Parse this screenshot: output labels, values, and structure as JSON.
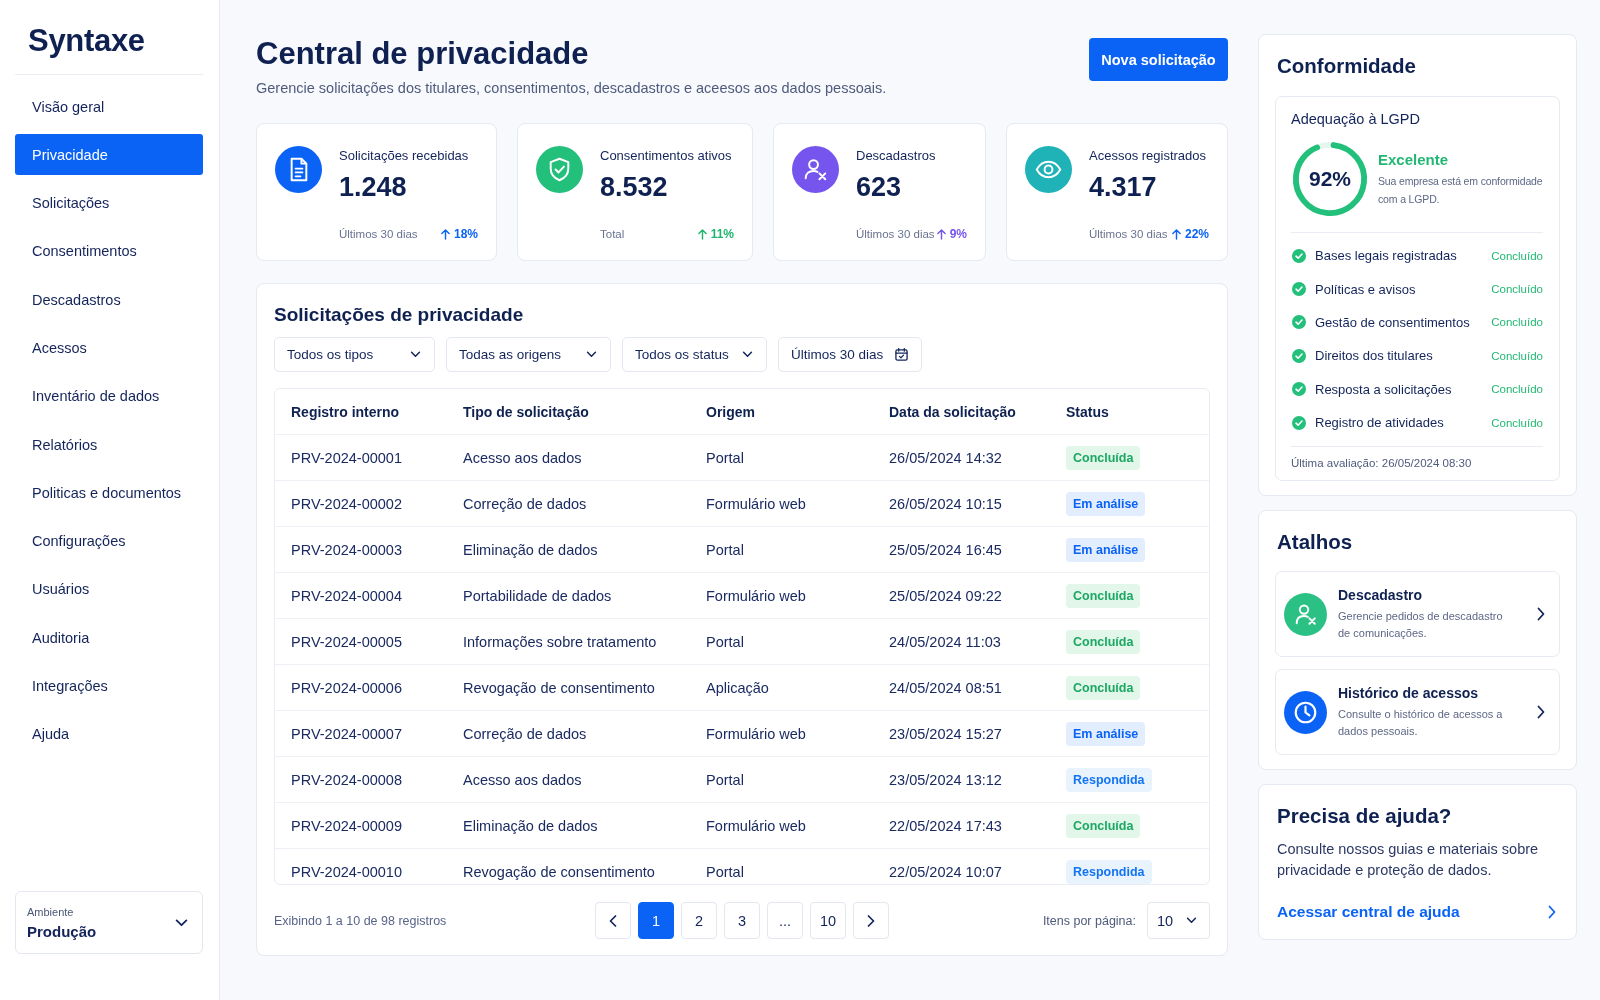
{
  "sidebar": {
    "logo": "Syntaxe",
    "items": [
      {
        "label": "Visão geral",
        "selected": false
      },
      {
        "label": "Privacidade",
        "selected": true
      },
      {
        "label": "Solicitações",
        "selected": false
      },
      {
        "label": "Consentimentos",
        "selected": false
      },
      {
        "label": "Descadastros",
        "selected": false
      },
      {
        "label": "Acessos",
        "selected": false
      },
      {
        "label": "Inventário de dados",
        "selected": false
      },
      {
        "label": "Relatórios",
        "selected": false
      },
      {
        "label": "Politicas e documentos",
        "selected": false
      },
      {
        "label": "Configurações",
        "selected": false
      },
      {
        "label": "Usuários",
        "selected": false
      },
      {
        "label": "Auditoria",
        "selected": false
      },
      {
        "label": "Integrações",
        "selected": false
      },
      {
        "label": "Ajuda",
        "selected": false
      }
    ],
    "environment": {
      "label": "Ambiente",
      "value": "Produção"
    }
  },
  "header": {
    "title": "Central de privacidade",
    "subtitle": "Gerencie solicitações dos titulares, consentimentos, descadastros e aceesos aos dados pessoais.",
    "primary_button": "Nova solicitação"
  },
  "stats": [
    {
      "kind": "document",
      "color": "#0b63f6",
      "label": "Solicitações recebidas",
      "value": "1.248",
      "period": "Últimos 30 dias",
      "trend": {
        "value": "18%",
        "color": "#0b63f6"
      }
    },
    {
      "kind": "shield",
      "color": "#22c07a",
      "label": "Consentimentos ativos",
      "value": "8.532",
      "period": "Total",
      "trend": {
        "value": "11%",
        "color": "#1fb46e"
      }
    },
    {
      "kind": "user-x",
      "color": "#7655ee",
      "label": "Descadastros",
      "value": "623",
      "period": "Últimos 30 dias",
      "trend": {
        "value": "9%",
        "color": "#7655ee"
      }
    },
    {
      "kind": "eye",
      "color": "#1fb3b8",
      "label": "Acessos registrados",
      "value": "4.317",
      "period": "Últimos 30 dias",
      "trend": {
        "value": "22%",
        "color": "#0b63f6"
      }
    }
  ],
  "requests": {
    "title": "Solicitações de privacidade",
    "filters": [
      {
        "kind": "select",
        "value": "Todos os tipos"
      },
      {
        "kind": "select",
        "value": "Todas as origens"
      },
      {
        "kind": "select",
        "value": "Todos os status"
      },
      {
        "kind": "date",
        "value": "Últimos 30 dias"
      }
    ],
    "table": {
      "columns": [
        "Registro interno",
        "Tipo de solicitação",
        "Origem",
        "Data da solicitação",
        "Status"
      ],
      "rows": [
        {
          "id": "PRV-2024-00001",
          "type": "Acesso aos dados",
          "origin": "Portal",
          "date": "26/05/2024 14:32",
          "status": {
            "label": "Concluída",
            "kind": "done"
          }
        },
        {
          "id": "PRV-2024-00002",
          "type": "Correção de dados",
          "origin": "Formulário web",
          "date": "26/05/2024 10:15",
          "status": {
            "label": "Em análise",
            "kind": "review"
          }
        },
        {
          "id": "PRV-2024-00003",
          "type": "Eliminação de dados",
          "origin": "Portal",
          "date": "25/05/2024 16:45",
          "status": {
            "label": "Em análise",
            "kind": "review"
          }
        },
        {
          "id": "PRV-2024-00004",
          "type": "Portabilidade de dados",
          "origin": "Formulário web",
          "date": "25/05/2024 09:22",
          "status": {
            "label": "Concluída",
            "kind": "done"
          }
        },
        {
          "id": "PRV-2024-00005",
          "type": "Informações sobre tratamento",
          "origin": "Portal",
          "date": "24/05/2024 11:03",
          "status": {
            "label": "Concluída",
            "kind": "done"
          }
        },
        {
          "id": "PRV-2024-00006",
          "type": "Revogação de consentimento",
          "origin": "Aplicação",
          "date": "24/05/2024 08:51",
          "status": {
            "label": "Concluída",
            "kind": "done"
          }
        },
        {
          "id": "PRV-2024-00007",
          "type": "Correção de dados",
          "origin": "Formulário web",
          "date": "23/05/2024 15:27",
          "status": {
            "label": "Em análise",
            "kind": "review"
          }
        },
        {
          "id": "PRV-2024-00008",
          "type": "Acesso aos dados",
          "origin": "Portal",
          "date": "23/05/2024 13:12",
          "status": {
            "label": "Respondida",
            "kind": "answered"
          }
        },
        {
          "id": "PRV-2024-00009",
          "type": "Eliminação de dados",
          "origin": "Formulário web",
          "date": "22/05/2024 17:43",
          "status": {
            "label": "Concluída",
            "kind": "done"
          }
        },
        {
          "id": "PRV-2024-00010",
          "type": "Revogação de consentimento",
          "origin": "Portal",
          "date": "22/05/2024 10:07",
          "status": {
            "label": "Respondida",
            "kind": "answered"
          }
        }
      ]
    },
    "pagination": {
      "summary": "Exibindo 1 a 10 de 98 registros",
      "pages": [
        {
          "label": "1",
          "selected": true
        },
        {
          "label": "2",
          "selected": false
        },
        {
          "label": "3",
          "selected": false
        },
        {
          "label": "...",
          "selected": false
        },
        {
          "label": "10",
          "selected": false
        }
      ],
      "per_page_label": "Itens por página:",
      "per_page_value": "10"
    }
  },
  "compliance": {
    "title": "Conformidade",
    "subtitle": "Adequação à LGPD",
    "score": "92%",
    "level": 0.92,
    "rating": "Excelente",
    "description": "Sua empresa está em conformidade com a LGPD.",
    "checklist": [
      {
        "label": "Bases legais registradas",
        "status": "Concluído",
        "done": true
      },
      {
        "label": "Políticas e avisos",
        "status": "Concluído",
        "done": true
      },
      {
        "label": "Gestão de consentimentos",
        "status": "Concluído",
        "done": true
      },
      {
        "label": "Direitos dos titulares",
        "status": "Concluído",
        "done": true
      },
      {
        "label": "Resposta a solicitações",
        "status": "Concluído",
        "done": true
      },
      {
        "label": "Registro de atividades",
        "status": "Concluído",
        "done": true
      }
    ],
    "last_review": "Última avaliação: 26/05/2024 08:30"
  },
  "shortcuts": {
    "title": "Atalhos",
    "items": [
      {
        "kind": "user-x",
        "color": "#2cc184",
        "title": "Descadastro",
        "description": "Gerencie pedidos de descadastro de comunicações."
      },
      {
        "kind": "clock",
        "color": "#0b63f6",
        "title": "Histórico de acessos",
        "description": "Consulte o histórico de acessos a dados pessoais."
      }
    ]
  },
  "help": {
    "title": "Precisa de ajuda?",
    "text": "Consulte nossos guias e materiais sobre privacidade e proteção de dados.",
    "link": "Acessar central de ajuda"
  }
}
